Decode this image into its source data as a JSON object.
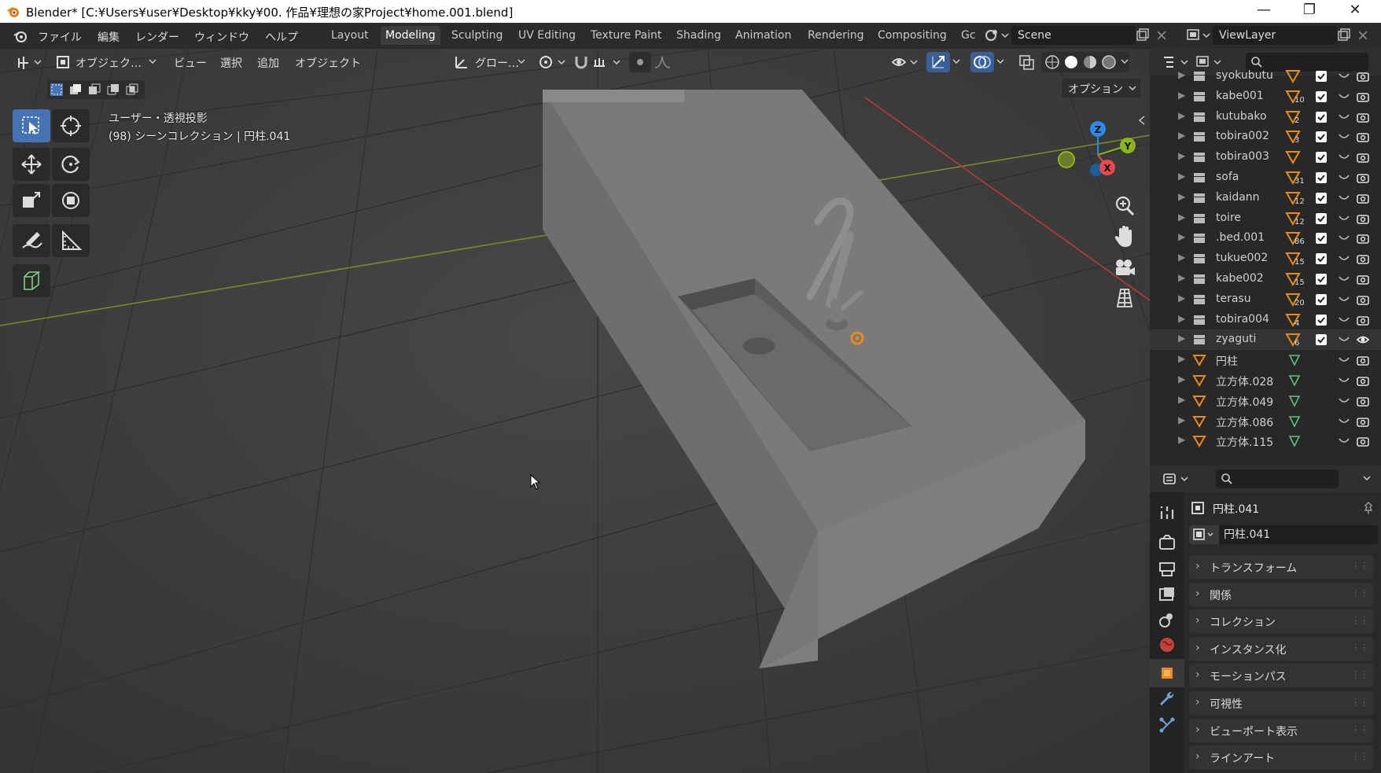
{
  "window": {
    "title": "Blender* [C:¥Users¥user¥Desktop¥kky¥00. 作品¥理想の家Project¥home.001.blend]",
    "minimize": "—",
    "maximize": "❐",
    "close": "✕"
  },
  "menu": {
    "file": "ファイル",
    "edit": "編集",
    "render": "レンダー",
    "window": "ウィンドウ",
    "help": "ヘルプ"
  },
  "workspaces": [
    "Layout",
    "Modeling",
    "Sculpting",
    "UV Editing",
    "Texture Paint",
    "Shading",
    "Animation",
    "Rendering",
    "Compositing",
    "Gc"
  ],
  "active_workspace": "Modeling",
  "scene": {
    "name": "Scene"
  },
  "viewlayer": {
    "name": "ViewLayer"
  },
  "viewport_header": {
    "mode": "オブジェク…",
    "view": "ビュー",
    "select": "選択",
    "add": "追加",
    "object": "オブジェクト",
    "transform_orientation": "グロー…",
    "options": "オプション"
  },
  "viewport_overlay": {
    "line1": "ユーザー・透視投影",
    "line2": "(98) シーンコレクション | 円柱.041"
  },
  "gizmo": {
    "x": "X",
    "y": "Y",
    "z": "Z"
  },
  "outliner": {
    "items": [
      {
        "name": "syokubutu",
        "count": ""
      },
      {
        "name": "kabe001",
        "count": "10"
      },
      {
        "name": "kutubako",
        "count": "2"
      },
      {
        "name": "tobira002",
        "count": "3"
      },
      {
        "name": "tobira003",
        "count": ""
      },
      {
        "name": "sofa",
        "count": "31"
      },
      {
        "name": "kaidann",
        "count": "12"
      },
      {
        "name": "toire",
        "count": "12"
      },
      {
        "name": ".bed.001",
        "count": "86"
      },
      {
        "name": "tukue002",
        "count": "15"
      },
      {
        "name": "kabe002",
        "count": "15"
      },
      {
        "name": "terasu",
        "count": "20"
      },
      {
        "name": "tobira004",
        "count": "4"
      },
      {
        "name": "zyaguti",
        "count": "6"
      },
      {
        "name": "円柱",
        "count": ""
      },
      {
        "name": "立方体.028",
        "count": ""
      },
      {
        "name": "立方体.049",
        "count": ""
      },
      {
        "name": "立方体.086",
        "count": ""
      },
      {
        "name": "立方体.115",
        "count": ""
      }
    ]
  },
  "properties": {
    "object_name": "円柱.041",
    "object_field": "円柱.041",
    "sections": [
      "トランスフォーム",
      "関係",
      "コレクション",
      "インスタンス化",
      "モーションパス",
      "可視性",
      "ビューポート表示",
      "ラインアート"
    ]
  },
  "colors": {
    "accent": "#4772b3",
    "x_axis": "#e64a4a",
    "y_axis": "#8bb51f",
    "z_axis": "#2c8be6",
    "object_origin": "#e88a1e"
  }
}
